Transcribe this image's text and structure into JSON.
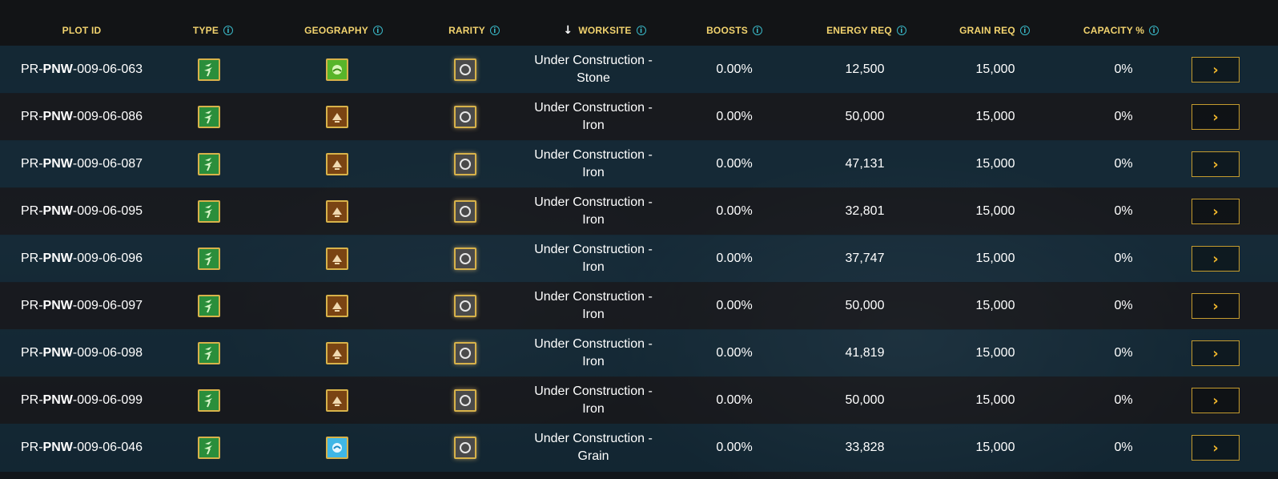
{
  "columns": {
    "plot_id": "PLOT ID",
    "type": "TYPE",
    "geography": "GEOGRAPHY",
    "rarity": "RARITY",
    "worksite": "WORKSITE",
    "boosts": "BOOSTS",
    "energy_req": "ENERGY REQ",
    "grain_req": "GRAIN REQ",
    "capacity": "CAPACITY %"
  },
  "sort": {
    "column": "worksite",
    "direction_icon": "arrow-down-icon",
    "glyph": "↓"
  },
  "icons": {
    "info": "i",
    "action": "›"
  },
  "colors": {
    "header_text": "#f2d36e",
    "info_icon": "#39b7c6",
    "type_badge": "#2a8e3b",
    "badge_border": "#d7b24a",
    "action_arrow": "#f0b62c"
  },
  "rows": [
    {
      "prefix": "PR-",
      "region": "PNW",
      "suffix": "-009-06-063",
      "type_icon": "plant-sprout-icon",
      "geo_icon": "grassland-icon",
      "rarity_icon": "common-ring-icon",
      "worksite_line1": "Under Construction -",
      "worksite_line2": "Stone",
      "boosts": "0.00%",
      "energy_req": "12,500",
      "grain_req": "15,000",
      "capacity": "0%"
    },
    {
      "prefix": "PR-",
      "region": "PNW",
      "suffix": "-009-06-086",
      "type_icon": "plant-sprout-icon",
      "geo_icon": "woodland-icon",
      "rarity_icon": "common-ring-icon",
      "worksite_line1": "Under Construction -",
      "worksite_line2": "Iron",
      "boosts": "0.00%",
      "energy_req": "50,000",
      "grain_req": "15,000",
      "capacity": "0%"
    },
    {
      "prefix": "PR-",
      "region": "PNW",
      "suffix": "-009-06-087",
      "type_icon": "plant-sprout-icon",
      "geo_icon": "woodland-icon",
      "rarity_icon": "common-ring-icon",
      "worksite_line1": "Under Construction -",
      "worksite_line2": "Iron",
      "boosts": "0.00%",
      "energy_req": "47,131",
      "grain_req": "15,000",
      "capacity": "0%"
    },
    {
      "prefix": "PR-",
      "region": "PNW",
      "suffix": "-009-06-095",
      "type_icon": "plant-sprout-icon",
      "geo_icon": "woodland-icon",
      "rarity_icon": "common-ring-icon",
      "worksite_line1": "Under Construction -",
      "worksite_line2": "Iron",
      "boosts": "0.00%",
      "energy_req": "32,801",
      "grain_req": "15,000",
      "capacity": "0%"
    },
    {
      "prefix": "PR-",
      "region": "PNW",
      "suffix": "-009-06-096",
      "type_icon": "plant-sprout-icon",
      "geo_icon": "woodland-icon",
      "rarity_icon": "common-ring-icon",
      "worksite_line1": "Under Construction -",
      "worksite_line2": "Iron",
      "boosts": "0.00%",
      "energy_req": "37,747",
      "grain_req": "15,000",
      "capacity": "0%"
    },
    {
      "prefix": "PR-",
      "region": "PNW",
      "suffix": "-009-06-097",
      "type_icon": "plant-sprout-icon",
      "geo_icon": "woodland-icon",
      "rarity_icon": "common-ring-icon",
      "worksite_line1": "Under Construction -",
      "worksite_line2": "Iron",
      "boosts": "0.00%",
      "energy_req": "50,000",
      "grain_req": "15,000",
      "capacity": "0%"
    },
    {
      "prefix": "PR-",
      "region": "PNW",
      "suffix": "-009-06-098",
      "type_icon": "plant-sprout-icon",
      "geo_icon": "woodland-icon",
      "rarity_icon": "common-ring-icon",
      "worksite_line1": "Under Construction -",
      "worksite_line2": "Iron",
      "boosts": "0.00%",
      "energy_req": "41,819",
      "grain_req": "15,000",
      "capacity": "0%"
    },
    {
      "prefix": "PR-",
      "region": "PNW",
      "suffix": "-009-06-099",
      "type_icon": "plant-sprout-icon",
      "geo_icon": "woodland-icon",
      "rarity_icon": "common-ring-icon",
      "worksite_line1": "Under Construction -",
      "worksite_line2": "Iron",
      "boosts": "0.00%",
      "energy_req": "50,000",
      "grain_req": "15,000",
      "capacity": "0%"
    },
    {
      "prefix": "PR-",
      "region": "PNW",
      "suffix": "-009-06-046",
      "type_icon": "plant-sprout-icon",
      "geo_icon": "water-icon",
      "rarity_icon": "common-ring-icon",
      "worksite_line1": "Under Construction -",
      "worksite_line2": "Grain",
      "boosts": "0.00%",
      "energy_req": "33,828",
      "grain_req": "15,000",
      "capacity": "0%"
    }
  ]
}
